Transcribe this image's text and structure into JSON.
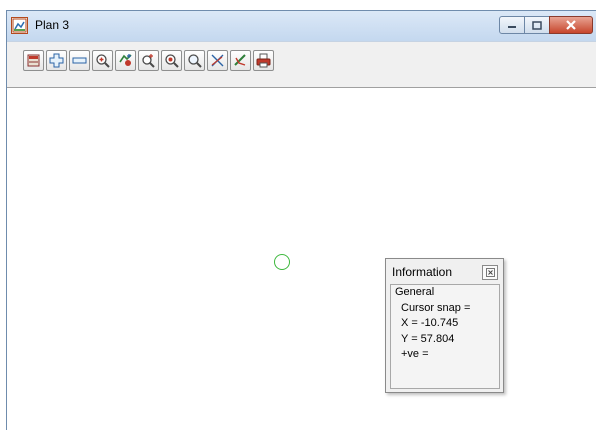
{
  "window": {
    "title": "Plan 3",
    "icon": "plan-view-icon"
  },
  "caption_buttons": [
    "minimize-icon",
    "maximize-icon",
    "close-icon"
  ],
  "toolbar": {
    "tools": [
      "plot-layers-icon",
      "zoom-in-plus-icon",
      "zoom-out-minus-icon",
      "zoom-extent-icon",
      "pan-icon",
      "zoom-window-icon",
      "zoom-centre-icon",
      "find-icon",
      "pick-cross-icon",
      "draw-tool-icon",
      "print-icon"
    ]
  },
  "info_panel": {
    "title": "Information",
    "section": "General",
    "cursor_snap": "Cursor snap =",
    "x": "X = -10.745",
    "y": "Y = 57.804",
    "ve": "+ve ="
  },
  "colors": {
    "titlebar": "#c9dbef",
    "close_button": "#c7452c",
    "cursor_circle": "#3db83d"
  }
}
